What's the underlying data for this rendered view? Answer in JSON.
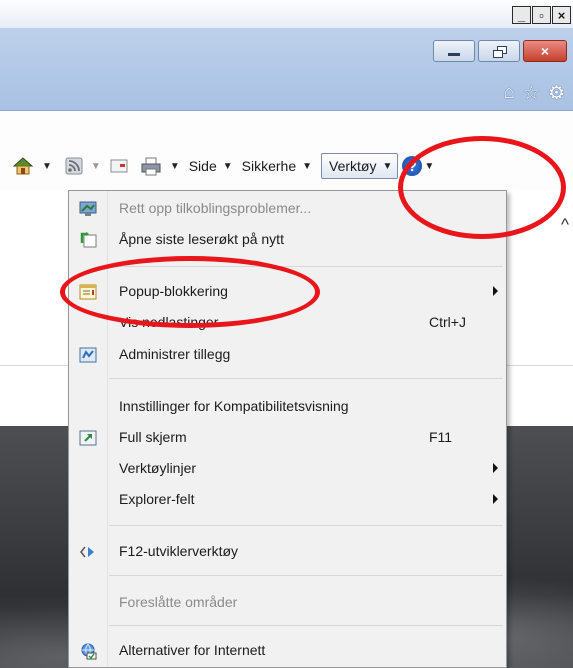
{
  "outer_window": {
    "minimize": "_",
    "restore": "▫",
    "close": "×"
  },
  "browser_window": {
    "close": "×"
  },
  "toolbar": {
    "side_label": "Side",
    "security_label": "Sikkerhe",
    "tools_label": "Verktøy",
    "help_label": "?"
  },
  "menu": {
    "items": [
      {
        "label": "Rett opp tilkoblingsproblemer...",
        "shortcut": "",
        "disabled": true
      },
      {
        "label": "Åpne siste leserøkt på nytt",
        "shortcut": ""
      },
      {
        "label": "Popup-blokkering",
        "shortcut": "",
        "submenu": true
      },
      {
        "label": "Vis nedlastinger",
        "shortcut": "Ctrl+J"
      },
      {
        "label": "Administrer tillegg",
        "shortcut": ""
      },
      {
        "label": "Innstillinger for Kompatibilitetsvisning",
        "shortcut": ""
      },
      {
        "label": "Full skjerm",
        "shortcut": "F11"
      },
      {
        "label": "Verktøylinjer",
        "shortcut": "",
        "submenu": true
      },
      {
        "label": "Explorer-felt",
        "shortcut": "",
        "submenu": true
      },
      {
        "label": "F12-utviklerverktøy",
        "shortcut": ""
      },
      {
        "label": "Foreslåtte områder",
        "shortcut": "",
        "disabled": true
      },
      {
        "label": "Alternativer for Internett",
        "shortcut": ""
      }
    ]
  },
  "colors": {
    "highlight_ring": "#e8151a",
    "chrome_blue": "#b4c9e8"
  }
}
